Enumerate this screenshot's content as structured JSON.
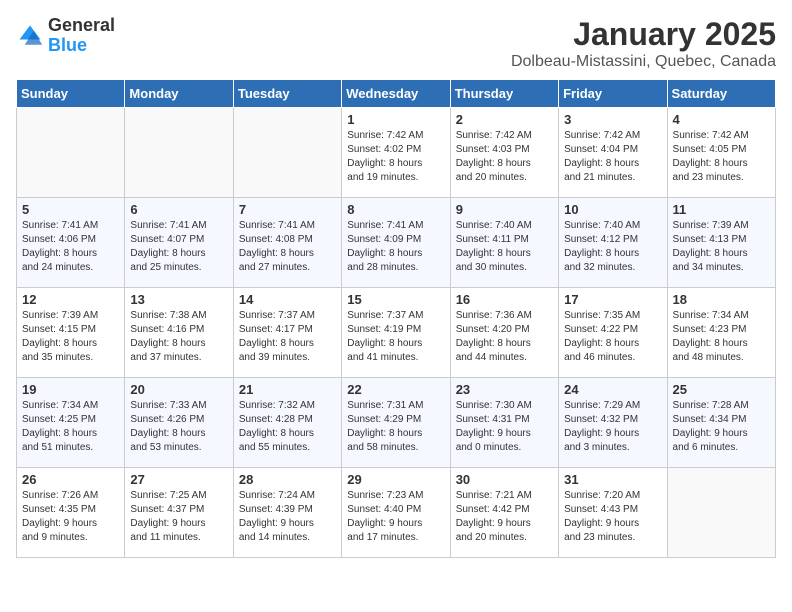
{
  "header": {
    "logo_general": "General",
    "logo_blue": "Blue",
    "title": "January 2025",
    "subtitle": "Dolbeau-Mistassini, Quebec, Canada"
  },
  "weekdays": [
    "Sunday",
    "Monday",
    "Tuesday",
    "Wednesday",
    "Thursday",
    "Friday",
    "Saturday"
  ],
  "weeks": [
    [
      {
        "day": "",
        "info": ""
      },
      {
        "day": "",
        "info": ""
      },
      {
        "day": "",
        "info": ""
      },
      {
        "day": "1",
        "info": "Sunrise: 7:42 AM\nSunset: 4:02 PM\nDaylight: 8 hours\nand 19 minutes."
      },
      {
        "day": "2",
        "info": "Sunrise: 7:42 AM\nSunset: 4:03 PM\nDaylight: 8 hours\nand 20 minutes."
      },
      {
        "day": "3",
        "info": "Sunrise: 7:42 AM\nSunset: 4:04 PM\nDaylight: 8 hours\nand 21 minutes."
      },
      {
        "day": "4",
        "info": "Sunrise: 7:42 AM\nSunset: 4:05 PM\nDaylight: 8 hours\nand 23 minutes."
      }
    ],
    [
      {
        "day": "5",
        "info": "Sunrise: 7:41 AM\nSunset: 4:06 PM\nDaylight: 8 hours\nand 24 minutes."
      },
      {
        "day": "6",
        "info": "Sunrise: 7:41 AM\nSunset: 4:07 PM\nDaylight: 8 hours\nand 25 minutes."
      },
      {
        "day": "7",
        "info": "Sunrise: 7:41 AM\nSunset: 4:08 PM\nDaylight: 8 hours\nand 27 minutes."
      },
      {
        "day": "8",
        "info": "Sunrise: 7:41 AM\nSunset: 4:09 PM\nDaylight: 8 hours\nand 28 minutes."
      },
      {
        "day": "9",
        "info": "Sunrise: 7:40 AM\nSunset: 4:11 PM\nDaylight: 8 hours\nand 30 minutes."
      },
      {
        "day": "10",
        "info": "Sunrise: 7:40 AM\nSunset: 4:12 PM\nDaylight: 8 hours\nand 32 minutes."
      },
      {
        "day": "11",
        "info": "Sunrise: 7:39 AM\nSunset: 4:13 PM\nDaylight: 8 hours\nand 34 minutes."
      }
    ],
    [
      {
        "day": "12",
        "info": "Sunrise: 7:39 AM\nSunset: 4:15 PM\nDaylight: 8 hours\nand 35 minutes."
      },
      {
        "day": "13",
        "info": "Sunrise: 7:38 AM\nSunset: 4:16 PM\nDaylight: 8 hours\nand 37 minutes."
      },
      {
        "day": "14",
        "info": "Sunrise: 7:37 AM\nSunset: 4:17 PM\nDaylight: 8 hours\nand 39 minutes."
      },
      {
        "day": "15",
        "info": "Sunrise: 7:37 AM\nSunset: 4:19 PM\nDaylight: 8 hours\nand 41 minutes."
      },
      {
        "day": "16",
        "info": "Sunrise: 7:36 AM\nSunset: 4:20 PM\nDaylight: 8 hours\nand 44 minutes."
      },
      {
        "day": "17",
        "info": "Sunrise: 7:35 AM\nSunset: 4:22 PM\nDaylight: 8 hours\nand 46 minutes."
      },
      {
        "day": "18",
        "info": "Sunrise: 7:34 AM\nSunset: 4:23 PM\nDaylight: 8 hours\nand 48 minutes."
      }
    ],
    [
      {
        "day": "19",
        "info": "Sunrise: 7:34 AM\nSunset: 4:25 PM\nDaylight: 8 hours\nand 51 minutes."
      },
      {
        "day": "20",
        "info": "Sunrise: 7:33 AM\nSunset: 4:26 PM\nDaylight: 8 hours\nand 53 minutes."
      },
      {
        "day": "21",
        "info": "Sunrise: 7:32 AM\nSunset: 4:28 PM\nDaylight: 8 hours\nand 55 minutes."
      },
      {
        "day": "22",
        "info": "Sunrise: 7:31 AM\nSunset: 4:29 PM\nDaylight: 8 hours\nand 58 minutes."
      },
      {
        "day": "23",
        "info": "Sunrise: 7:30 AM\nSunset: 4:31 PM\nDaylight: 9 hours\nand 0 minutes."
      },
      {
        "day": "24",
        "info": "Sunrise: 7:29 AM\nSunset: 4:32 PM\nDaylight: 9 hours\nand 3 minutes."
      },
      {
        "day": "25",
        "info": "Sunrise: 7:28 AM\nSunset: 4:34 PM\nDaylight: 9 hours\nand 6 minutes."
      }
    ],
    [
      {
        "day": "26",
        "info": "Sunrise: 7:26 AM\nSunset: 4:35 PM\nDaylight: 9 hours\nand 9 minutes."
      },
      {
        "day": "27",
        "info": "Sunrise: 7:25 AM\nSunset: 4:37 PM\nDaylight: 9 hours\nand 11 minutes."
      },
      {
        "day": "28",
        "info": "Sunrise: 7:24 AM\nSunset: 4:39 PM\nDaylight: 9 hours\nand 14 minutes."
      },
      {
        "day": "29",
        "info": "Sunrise: 7:23 AM\nSunset: 4:40 PM\nDaylight: 9 hours\nand 17 minutes."
      },
      {
        "day": "30",
        "info": "Sunrise: 7:21 AM\nSunset: 4:42 PM\nDaylight: 9 hours\nand 20 minutes."
      },
      {
        "day": "31",
        "info": "Sunrise: 7:20 AM\nSunset: 4:43 PM\nDaylight: 9 hours\nand 23 minutes."
      },
      {
        "day": "",
        "info": ""
      }
    ]
  ]
}
